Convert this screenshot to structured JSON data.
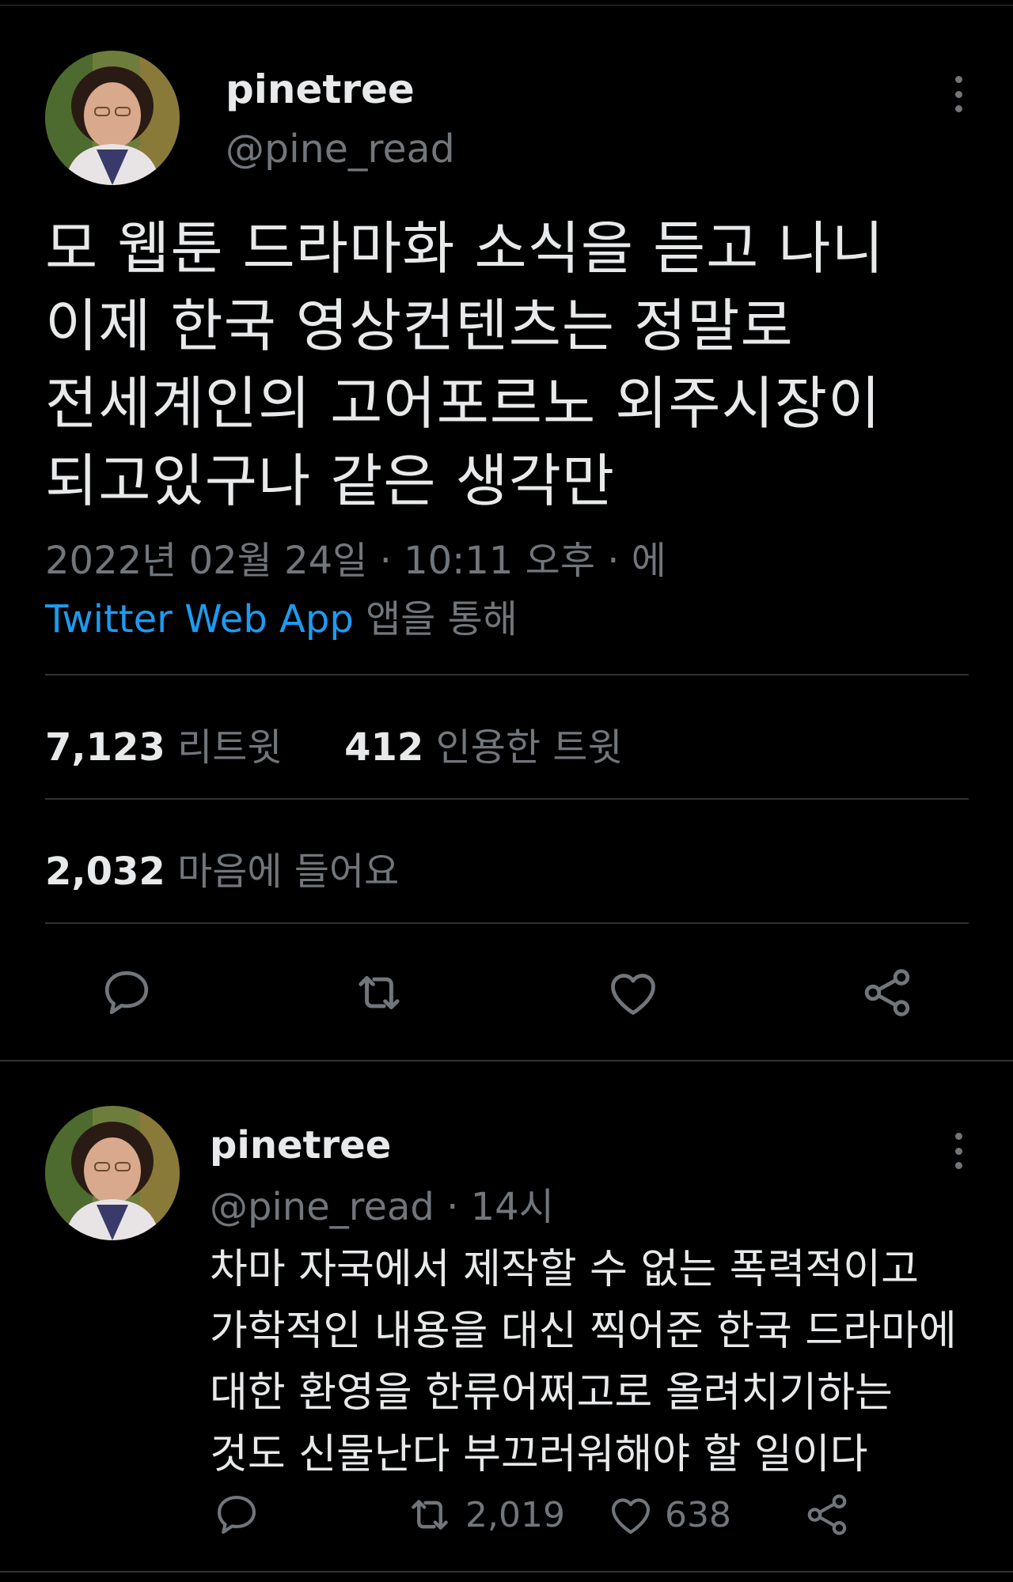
{
  "main_tweet": {
    "user": {
      "name": "pinetree",
      "handle": "@pine_read"
    },
    "text_lines": [
      "모 웹툰 드라마화 소식을 듣고 나니",
      "이제 한국 영상컨텐츠는 정말로",
      "전세계인의 고어포르노 외주시장이",
      "되고있구나 같은 생각만"
    ],
    "timestamp": "2022년 02월 24일 · 10:11 오후 · 에",
    "source_app": "Twitter Web App",
    "source_suffix": " 앱을 통해",
    "retweets": {
      "count": "7,123",
      "label": "리트윗"
    },
    "quotes": {
      "count": "412",
      "label": "인용한 트윗"
    },
    "likes": {
      "count": "2,032",
      "label": "마음에 들어요"
    },
    "action_icons": [
      "reply-icon",
      "retweet-icon",
      "like-icon",
      "share-icon"
    ]
  },
  "reply_tweet": {
    "user": {
      "name": "pinetree",
      "handle": "@pine_read",
      "time": " · 14시"
    },
    "text_lines": [
      "차마 자국에서 제작할 수 없는 폭력적이고",
      "가학적인 내용을 대신 찍어준 한국 드라마에",
      "대한 환영을 한류어쩌고로 올려치기하는",
      "것도 신물난다 부끄러워해야 할 일이다"
    ],
    "retweet_count": "2,019",
    "like_count": "638"
  },
  "colors": {
    "background": "#000000",
    "text": "#e7e9ea",
    "secondary": "#71767b",
    "link": "#1d9bf0",
    "divider": "#2f3336"
  }
}
